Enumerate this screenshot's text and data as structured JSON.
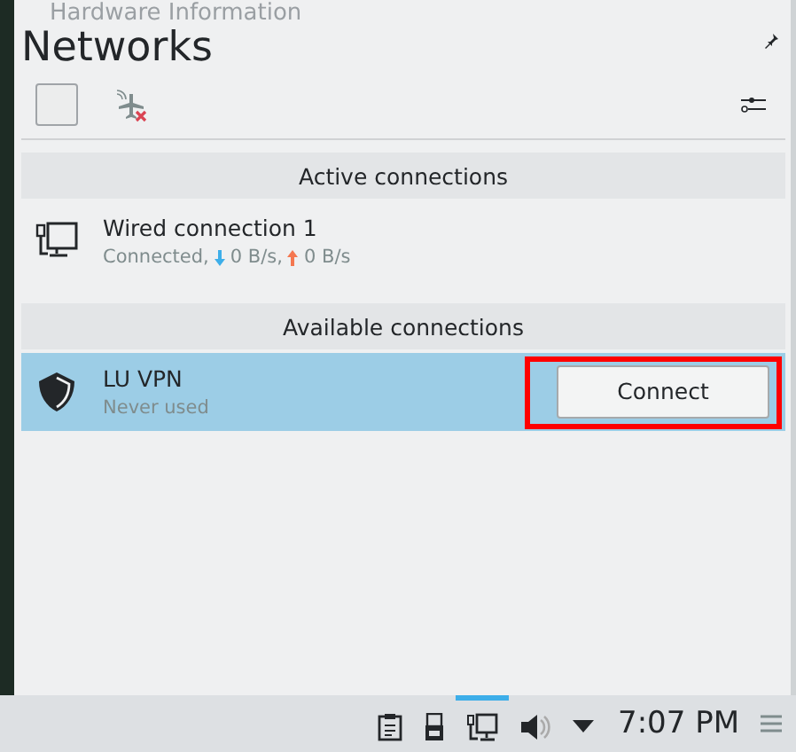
{
  "background_window": {
    "title": "Hardware Information"
  },
  "popup": {
    "title": "Networks",
    "pinned": false,
    "toolbar": {
      "wireless_enabled": false,
      "airplane_mode": false
    },
    "sections": [
      {
        "header": "Active connections",
        "rows": [
          {
            "kind": "wired",
            "name": "Wired connection 1",
            "status": "Connected,",
            "download": "0 B/s,",
            "upload": "0 B/s",
            "selected": false
          }
        ]
      },
      {
        "header": "Available connections",
        "rows": [
          {
            "kind": "vpn",
            "name": "LU VPN",
            "status": "Never used",
            "button": "Connect",
            "highlighted": true,
            "selected": true
          }
        ]
      }
    ]
  },
  "tray": {
    "items": [
      {
        "kind": "clipboard",
        "active": false
      },
      {
        "kind": "usb",
        "active": false
      },
      {
        "kind": "network",
        "active": true
      },
      {
        "kind": "volume",
        "active": false
      },
      {
        "kind": "expand",
        "active": false
      }
    ],
    "clock": "7:07 PM"
  }
}
